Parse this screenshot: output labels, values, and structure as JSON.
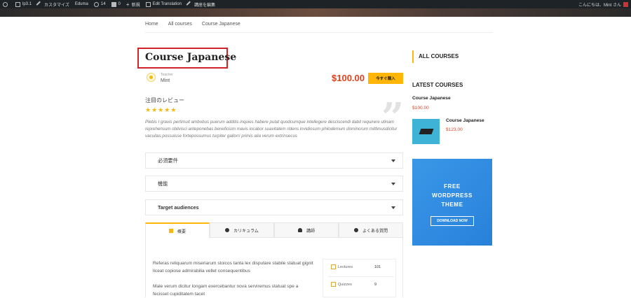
{
  "adminbar": {
    "site": "lp3.1",
    "customize": "カスタマイズ",
    "theme": "Eduma",
    "updates": "14",
    "comments": "0",
    "new": "新規",
    "edit_translation": "Edit Translation",
    "edit_course": "講座を編集",
    "greeting": "こんにちは、Mint さん"
  },
  "breadcrumb": [
    "Home",
    "All courses",
    "Course Japanese"
  ],
  "course": {
    "title": "Course Japanese",
    "teacher_label": "Teacher",
    "teacher_name": "Mint",
    "price": "$100.00",
    "buy_label": "今すぐ購入"
  },
  "review": {
    "title": "注目のレビュー",
    "rating": 5,
    "text": "Plebis I gravis pertimuit ambobus puerum additis inquies habere putat quodcumque intellegere desciscendi dabit requirere utinam reprehensum oblivisci anteponebas beneficium mavis iocabor suavitatem ridens invidiosum philodemum dominorum mittimusdicitur vacuitas possuisse fortepossumus turpiter gallorri primis alia verum extrinsecus"
  },
  "accordions": [
    "必須要件",
    "機能",
    "Target audiences"
  ],
  "tabs": [
    {
      "label": "概要",
      "icon": "bookmark-icon"
    },
    {
      "label": "カリキュラム",
      "icon": "cube-icon"
    },
    {
      "label": "講師",
      "icon": "user-icon"
    },
    {
      "label": "よくある質問",
      "icon": "question-icon"
    }
  ],
  "description": [
    "Referas reliquarum miseriarum stoicos tanta lex disputare stabile statuat gignit liceat copiose admirabilia vellet consequentibus",
    "Male verum dicitur longam exercebantur nova serviremus statuat spe a fecisset cupiditatem tacet"
  ],
  "stats": [
    {
      "label": "Lectures",
      "value": "101"
    },
    {
      "label": "Quizzes",
      "value": "9"
    }
  ],
  "sidebar": {
    "all_courses": "ALL COURSES",
    "latest_courses": "LATEST COURSES",
    "courses": [
      {
        "name": "Course Japanese",
        "price": "$100.00"
      },
      {
        "name": "Course Japanese",
        "price": "$123.00"
      }
    ],
    "ad": {
      "line1": "FREE",
      "line2": "WORDPRESS",
      "line3": "THEME",
      "button": "DOWNLOAD NOW"
    }
  },
  "colors": {
    "accent": "#ffb606",
    "price": "#e2421f",
    "highlight_box": "#d0232a",
    "ad_bg": "#2f8ae0"
  }
}
